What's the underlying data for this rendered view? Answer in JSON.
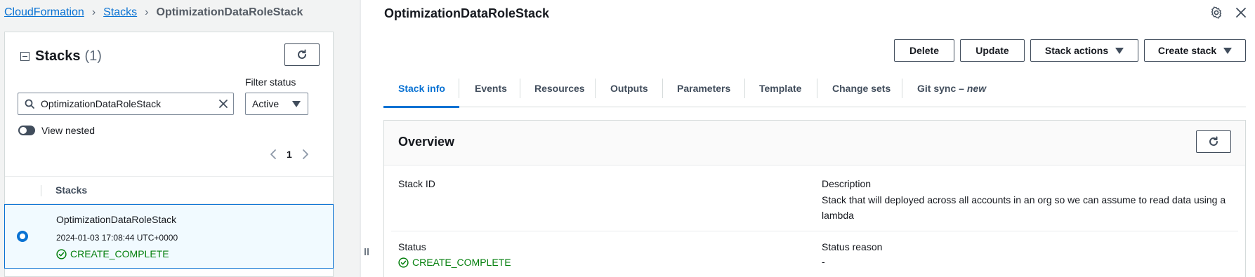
{
  "breadcrumb": {
    "items": [
      "CloudFormation",
      "Stacks"
    ],
    "current": "OptimizationDataRoleStack"
  },
  "stacks_panel": {
    "title": "Stacks",
    "count": "(1)",
    "filter_label": "Filter status",
    "search_value": "OptimizationDataRoleStack",
    "status_filter": "Active",
    "view_nested_label": "View nested",
    "page": "1",
    "column_header": "Stacks",
    "rows": [
      {
        "name": "OptimizationDataRoleStack",
        "created": "2024-01-03 17:08:44 UTC+0000",
        "status": "CREATE_COMPLETE",
        "selected": true
      }
    ]
  },
  "detail": {
    "title": "OptimizationDataRoleStack",
    "buttons": {
      "delete": "Delete",
      "update": "Update",
      "stack_actions": "Stack actions",
      "create_stack": "Create stack"
    },
    "tabs": [
      {
        "label": "Stack info",
        "active": true
      },
      {
        "label": "Events"
      },
      {
        "label": "Resources"
      },
      {
        "label": "Outputs"
      },
      {
        "label": "Parameters"
      },
      {
        "label": "Template"
      },
      {
        "label": "Change sets"
      },
      {
        "label": "Git sync –",
        "tag": "new"
      }
    ],
    "overview": {
      "title": "Overview",
      "stack_id_label": "Stack ID",
      "stack_id_value": "",
      "description_label": "Description",
      "description_value": "Stack that will deployed across all accounts in an org so we can assume to read data using a lambda",
      "status_label": "Status",
      "status_value": "CREATE_COMPLETE",
      "status_reason_label": "Status reason",
      "status_reason_value": "-"
    }
  },
  "colors": {
    "link": "#0972d3",
    "success": "#037f0c",
    "selected_row_bg": "#f1faff"
  },
  "icons": [
    "search-icon",
    "clear-icon",
    "refresh-icon",
    "chevron-left-icon",
    "chevron-right-icon",
    "success-check-icon",
    "gear-icon",
    "close-icon",
    "caret-down-icon",
    "collapse-icon",
    "drag-handle-icon"
  ]
}
